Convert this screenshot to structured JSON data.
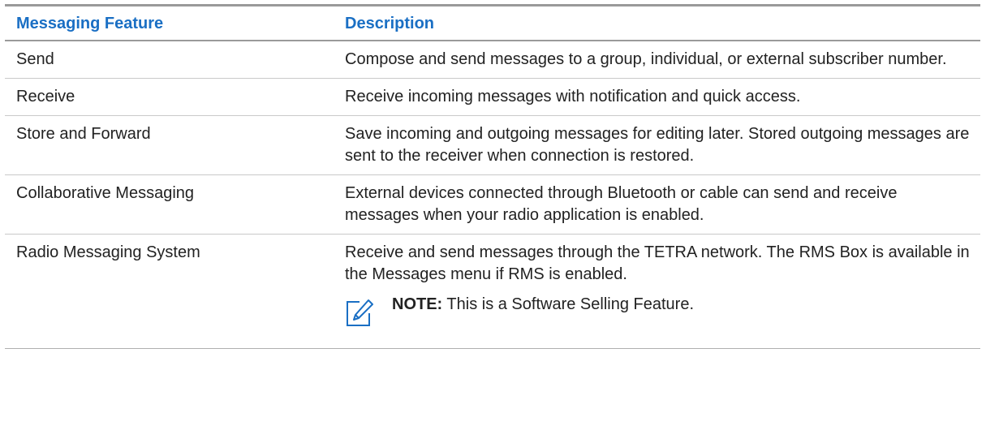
{
  "table": {
    "headers": [
      "Messaging Feature",
      "Description"
    ],
    "rows": [
      {
        "feature": "Send",
        "description": "Compose and send messages to a group, individual, or external subscriber number."
      },
      {
        "feature": "Receive",
        "description": "Receive incoming messages with notification and quick access."
      },
      {
        "feature": "Store and Forward",
        "description": "Save incoming and outgoing messages for editing later. Stored outgoing messages are sent to the receiver when connection is restored."
      },
      {
        "feature": "Collaborative Messaging",
        "description": "External devices connected through Bluetooth or cable can send and receive messages when your radio application is enabled."
      },
      {
        "feature": "Radio Messaging System",
        "description": "Receive and send messages through the TETRA network. The RMS Box is available in the Messages menu if RMS is enabled."
      }
    ],
    "note": {
      "label": "NOTE:",
      "text": " This is a Software Selling Feature.",
      "icon": "note-edit-icon"
    }
  },
  "colors": {
    "header_text": "#1a6fc4",
    "rule": "#9a9a9a",
    "icon": "#1a6fc4"
  }
}
